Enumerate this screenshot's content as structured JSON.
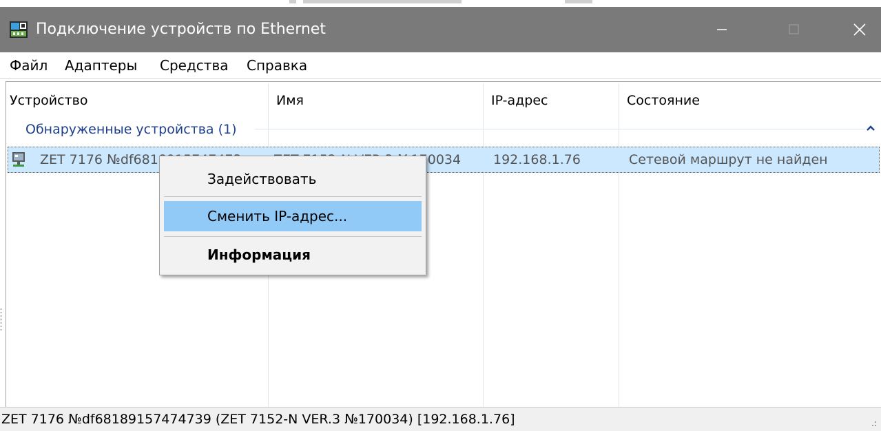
{
  "window": {
    "title": "Подключение устройств по Ethernet",
    "icon": "ethernet-app-icon",
    "controls": [
      "minimize-icon",
      "maximize-icon",
      "close-icon"
    ]
  },
  "menubar": {
    "items": [
      "Файл",
      "Адаптеры",
      "Средства",
      "Справка"
    ]
  },
  "table": {
    "columns": [
      "Устройство",
      "Имя",
      "IP-адрес",
      "Состояние"
    ],
    "group": {
      "label": "Обнаруженные устройства (1)",
      "collapse_icon": "chevron-up-icon"
    },
    "rows": [
      {
        "device": "ZET 7176 №df6818915747473",
        "name": "ZET 7152-N VER.3 №170034",
        "ip": "192.168.1.76",
        "status": "Сетевой маршрут не найден",
        "icon": "network-device-icon",
        "selected": true
      }
    ]
  },
  "context_menu": {
    "items": [
      {
        "label": "Задействовать",
        "highlighted": false,
        "bold": false
      },
      {
        "label": "Сменить IP-адрес...",
        "highlighted": true,
        "bold": false
      },
      {
        "label": "Информация",
        "highlighted": false,
        "bold": true
      }
    ]
  },
  "statusbar": {
    "text": "ZET 7176 №df68189157474739 (ZET 7152-N VER.3 №170034) [192.168.1.76]"
  },
  "colors": {
    "titlebar": "#7a7a7a",
    "selection": "#cce8ff",
    "menu_highlight": "#91c9f7",
    "group_text": "#1e3f8a"
  }
}
